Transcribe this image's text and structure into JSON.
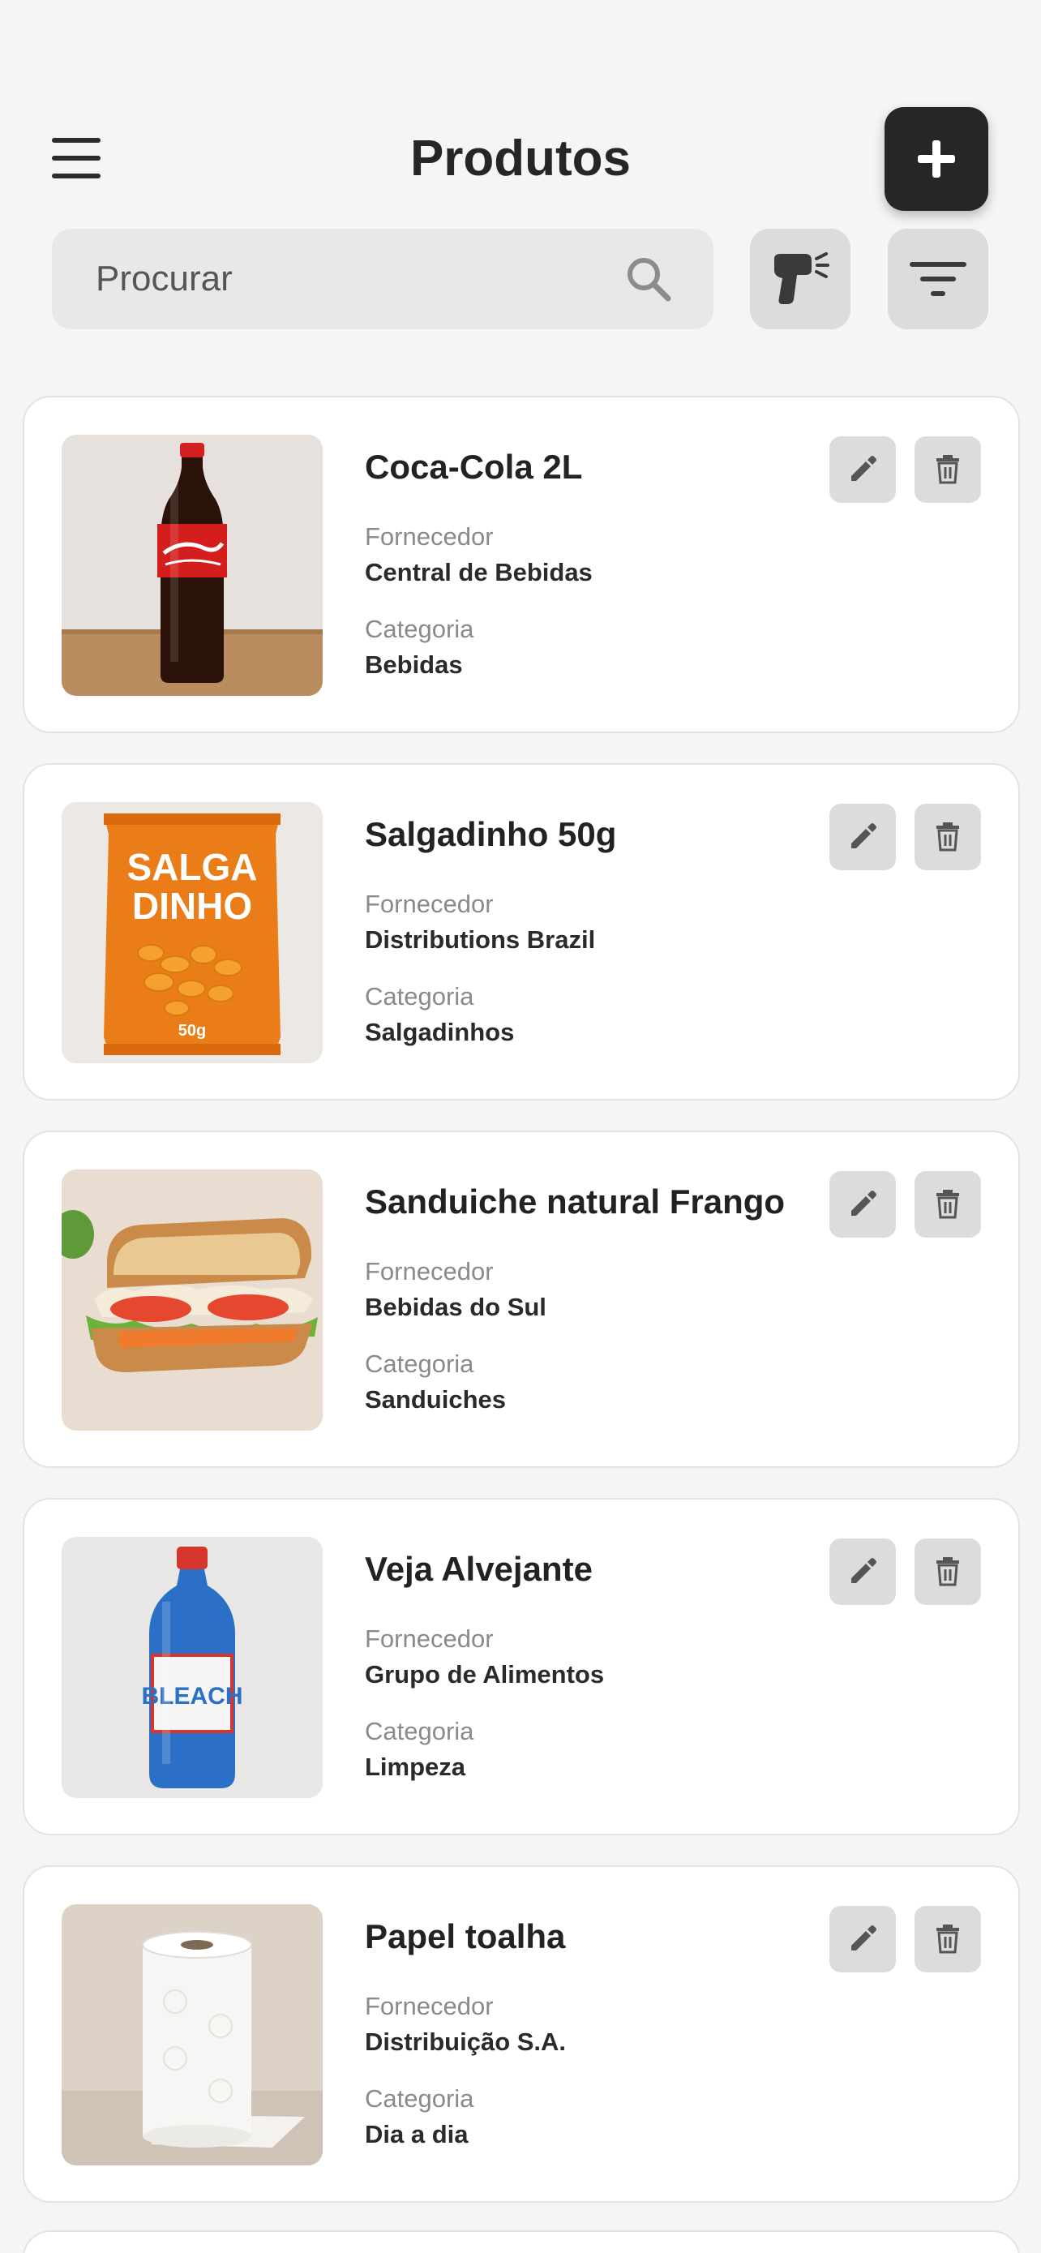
{
  "header": {
    "title": "Produtos"
  },
  "search": {
    "placeholder": "Procurar"
  },
  "labels": {
    "supplier": "Fornecedor",
    "category": "Categoria"
  },
  "products": [
    {
      "name": "Coca-Cola 2L",
      "supplier": "Central de Bebidas",
      "category": "Bebidas",
      "image_icon": "soda-bottle-image"
    },
    {
      "name": "Salgadinho 50g",
      "supplier": "Distributions Brazil",
      "category": "Salgadinhos",
      "image_icon": "snack-bag-image",
      "package_text": [
        "SALGA",
        "DINHO",
        "50g"
      ]
    },
    {
      "name": "Sanduiche natural Frango",
      "supplier": "Bebidas do Sul",
      "category": "Sanduiches",
      "image_icon": "sandwich-image"
    },
    {
      "name": "Veja Alvejante",
      "supplier": "Grupo de Alimentos",
      "category": "Limpeza",
      "image_icon": "bleach-bottle-image",
      "package_text": [
        "BLEACH"
      ]
    },
    {
      "name": "Papel toalha",
      "supplier": "Distribuição S.A.",
      "category": "Dia a dia",
      "image_icon": "paper-towel-image"
    }
  ],
  "colors": {
    "accent": "#262626",
    "background": "#f5f5f5",
    "button": "#dcdcdc"
  }
}
